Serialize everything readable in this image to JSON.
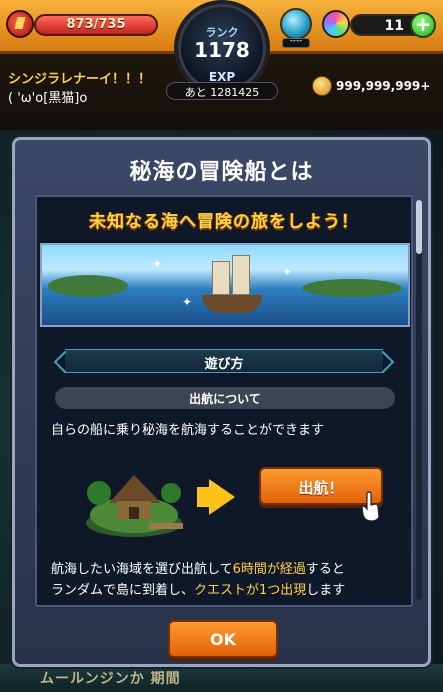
{
  "header": {
    "stamina": {
      "current": "873",
      "max": "/735",
      "fill_fraction": 1.0,
      "icon": "stamina-icon"
    },
    "rank": {
      "label": "ランク",
      "value": "1178"
    },
    "exp": {
      "label": "EXP",
      "remaining": "あと 1281425"
    },
    "orb": {
      "icon": "orb-icon",
      "label": "----"
    },
    "gems": {
      "count": "11",
      "icon": "gem-icon",
      "add_label": "+"
    },
    "username": "シンジラレナーイ！！！",
    "subname": "( 'ω'o[黒猫]o",
    "coins": {
      "amount": "999,999,999+",
      "icon": "coin-icon"
    }
  },
  "dialog": {
    "title": "秘海の冒険船とは",
    "tagline": "未知なる海へ冒険の旅をしよう！",
    "howto_label": "遊び方",
    "section_label": "出航について",
    "desc1": "自らの船に乗り秘海を航海することができます",
    "depart_button": "出航！",
    "desc2_line1_a": "航海したい海域を選び出航して",
    "desc2_line1_hl": "6時間が経過",
    "desc2_line1_b": "すると",
    "desc2_line2_a": "ランダムで島に到着し、",
    "desc2_line2_hl": "クエストが1つ出現",
    "desc2_line2_b": "します",
    "ok_button": "OK",
    "scroll_position": 0.0
  },
  "background": {
    "strip_text": "ムールンジンか 期間"
  },
  "colors": {
    "accent": "#ffcf4a",
    "button_orange": "#e0620a",
    "dialog_bg": "#3b4866"
  }
}
